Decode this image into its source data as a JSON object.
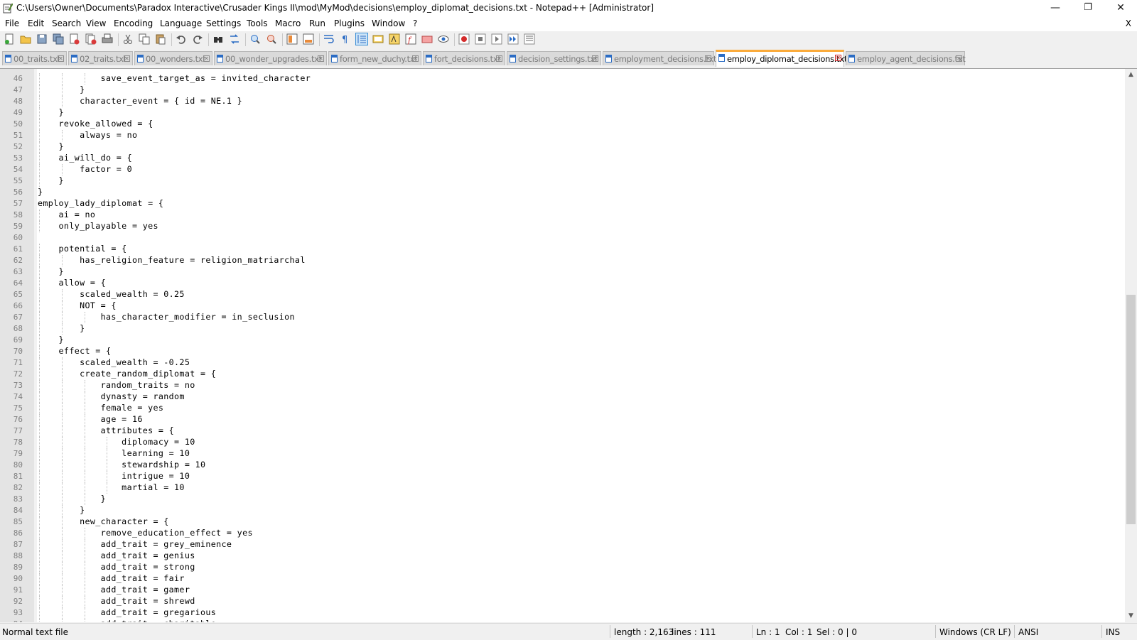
{
  "window": {
    "title": "C:\\Users\\Owner\\Documents\\Paradox Interactive\\Crusader Kings II\\mod\\MyMod\\decisions\\employ_diplomat_decisions.txt - Notepad++ [Administrator]",
    "minimize": "—",
    "restore": "❐",
    "close": "✕"
  },
  "menu": {
    "items": [
      "File",
      "Edit",
      "Search",
      "View",
      "Encoding",
      "Language",
      "Settings",
      "Tools",
      "Macro",
      "Run",
      "Plugins",
      "Window",
      "?"
    ],
    "close_doc": "X"
  },
  "tabs": [
    {
      "label": "00_traits.txt",
      "active": false
    },
    {
      "label": "02_traits.txt",
      "active": false
    },
    {
      "label": "00_wonders.txt",
      "active": false
    },
    {
      "label": "00_wonder_upgrades.txt",
      "active": false
    },
    {
      "label": "form_new_duchy.txt",
      "active": false
    },
    {
      "label": "fort_decisions.txt",
      "active": false
    },
    {
      "label": "decision_settings.txt",
      "active": false
    },
    {
      "label": "employment_decisions.txt",
      "active": false
    },
    {
      "label": "employ_diplomat_decisions.txt",
      "active": true
    },
    {
      "label": "employ_agent_decisions.txt",
      "active": false
    }
  ],
  "editor": {
    "lines": [
      {
        "n": "46",
        "text": "            save_event_target_as = invited_character"
      },
      {
        "n": "47",
        "text": "        }"
      },
      {
        "n": "48",
        "text": "        character_event = { id = NE.1 }"
      },
      {
        "n": "49",
        "text": "    }"
      },
      {
        "n": "50",
        "text": "    revoke_allowed = {"
      },
      {
        "n": "51",
        "text": "        always = no"
      },
      {
        "n": "52",
        "text": "    }"
      },
      {
        "n": "53",
        "text": "    ai_will_do = {"
      },
      {
        "n": "54",
        "text": "        factor = 0"
      },
      {
        "n": "55",
        "text": "    }"
      },
      {
        "n": "56",
        "text": "}"
      },
      {
        "n": "57",
        "text": "employ_lady_diplomat = {"
      },
      {
        "n": "58",
        "text": "    ai = no"
      },
      {
        "n": "59",
        "text": "    only_playable = yes"
      },
      {
        "n": "60",
        "text": ""
      },
      {
        "n": "61",
        "text": "    potential = {"
      },
      {
        "n": "62",
        "text": "        has_religion_feature = religion_matriarchal"
      },
      {
        "n": "63",
        "text": "    }"
      },
      {
        "n": "64",
        "text": "    allow = {"
      },
      {
        "n": "65",
        "text": "        scaled_wealth = 0.25"
      },
      {
        "n": "66",
        "text": "        NOT = {"
      },
      {
        "n": "67",
        "text": "            has_character_modifier = in_seclusion"
      },
      {
        "n": "68",
        "text": "        }"
      },
      {
        "n": "69",
        "text": "    }"
      },
      {
        "n": "70",
        "text": "    effect = {"
      },
      {
        "n": "71",
        "text": "        scaled_wealth = -0.25"
      },
      {
        "n": "72",
        "text": "        create_random_diplomat = {"
      },
      {
        "n": "73",
        "text": "            random_traits = no"
      },
      {
        "n": "74",
        "text": "            dynasty = random"
      },
      {
        "n": "75",
        "text": "            female = yes"
      },
      {
        "n": "76",
        "text": "            age = 16"
      },
      {
        "n": "77",
        "text": "            attributes = {"
      },
      {
        "n": "78",
        "text": "                diplomacy = 10"
      },
      {
        "n": "79",
        "text": "                learning = 10"
      },
      {
        "n": "80",
        "text": "                stewardship = 10"
      },
      {
        "n": "81",
        "text": "                intrigue = 10"
      },
      {
        "n": "82",
        "text": "                martial = 10"
      },
      {
        "n": "83",
        "text": "            }"
      },
      {
        "n": "84",
        "text": "        }"
      },
      {
        "n": "85",
        "text": "        new_character = {"
      },
      {
        "n": "86",
        "text": "            remove_education_effect = yes"
      },
      {
        "n": "87",
        "text": "            add_trait = grey_eminence"
      },
      {
        "n": "88",
        "text": "            add_trait = genius"
      },
      {
        "n": "89",
        "text": "            add_trait = strong"
      },
      {
        "n": "90",
        "text": "            add_trait = fair"
      },
      {
        "n": "91",
        "text": "            add_trait = gamer"
      },
      {
        "n": "92",
        "text": "            add_trait = shrewd"
      },
      {
        "n": "93",
        "text": "            add_trait = gregarious"
      },
      {
        "n": "94",
        "text": "            add_trait = charitable"
      }
    ]
  },
  "status": {
    "file_type": "Normal text file",
    "length": "length : 2,163",
    "lines": "lines : 111",
    "ln": "Ln : 1",
    "col": "Col : 1",
    "sel": "Sel : 0 | 0",
    "eol": "Windows (CR LF)",
    "encoding": "ANSI",
    "mode": "INS"
  },
  "colors": {
    "accent_tab": "#fbab3b",
    "tab_close_active": "#d42c2c",
    "gutter": "#e4e4e4"
  }
}
